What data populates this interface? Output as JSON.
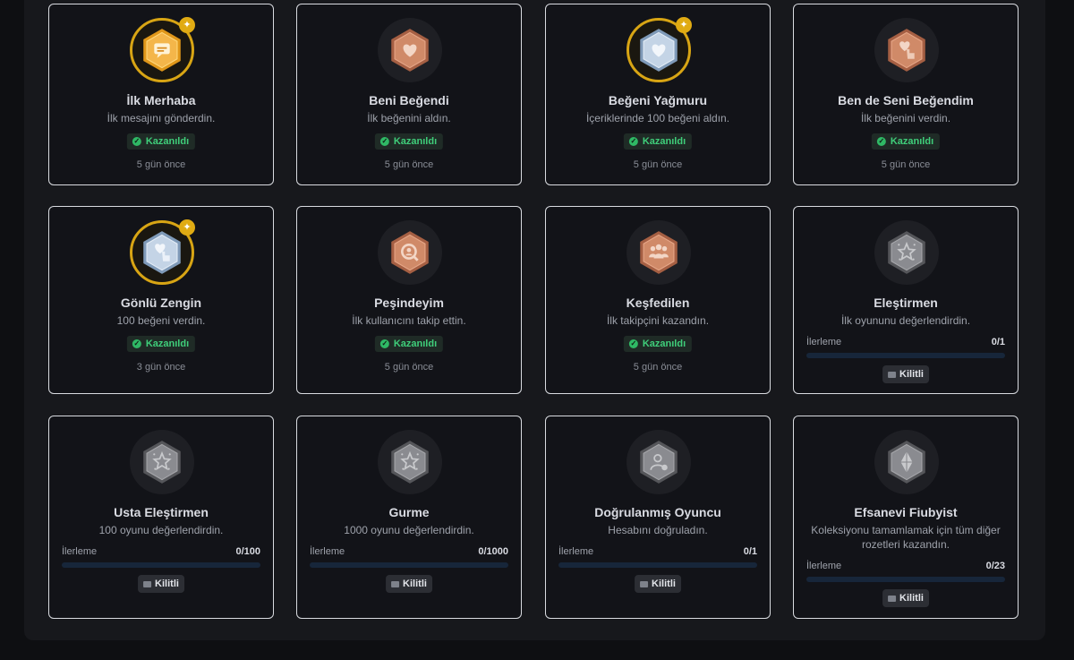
{
  "cards": [
    {
      "title": "İlk Merhaba",
      "desc": "İlk mesajını gönderdin.",
      "status": "Kazanıldı",
      "time": "5 gün önce",
      "tier": "gold",
      "icon": "chat-bubble-icon",
      "pinned": true
    },
    {
      "title": "Beni Beğendi",
      "desc": "İlk beğenini aldın.",
      "status": "Kazanıldı",
      "time": "5 gün önce",
      "tier": "bronze",
      "icon": "heart-icon",
      "pinned": false
    },
    {
      "title": "Beğeni Yağmuru",
      "desc": "İçeriklerinde 100 beğeni aldın.",
      "status": "Kazanıldı",
      "time": "5 gün önce",
      "tier": "silver",
      "icon": "hearts-icon",
      "pinned": true
    },
    {
      "title": "Ben de Seni Beğendim",
      "desc": "İlk beğenini verdin.",
      "status": "Kazanıldı",
      "time": "5 gün önce",
      "tier": "bronze",
      "icon": "heart-hand-icon",
      "pinned": false
    },
    {
      "title": "Gönlü Zengin",
      "desc": "100 beğeni verdin.",
      "status": "Kazanıldı",
      "time": "3 gün önce",
      "tier": "silver",
      "icon": "heart-hand-icon",
      "pinned": true
    },
    {
      "title": "Peşindeyim",
      "desc": "İlk kullanıcını takip ettin.",
      "status": "Kazanıldı",
      "time": "5 gün önce",
      "tier": "bronze",
      "icon": "magnifier-user-icon",
      "pinned": false
    },
    {
      "title": "Keşfedilen",
      "desc": "İlk takipçini kazandın.",
      "status": "Kazanıldı",
      "time": "5 gün önce",
      "tier": "bronze",
      "icon": "group-icon",
      "pinned": false
    },
    {
      "title": "Eleştirmen",
      "desc": "İlk oyununu değerlendirdin.",
      "tier": "locked",
      "icon": "star-icon",
      "progress_label": "İlerleme",
      "progress_text": "0/1",
      "progress": 0,
      "lock_label": "Kilitli"
    },
    {
      "title": "Usta Eleştirmen",
      "desc": "100 oyunu değerlendirdin.",
      "tier": "locked",
      "icon": "star-icon",
      "progress_label": "İlerleme",
      "progress_text": "0/100",
      "progress": 0,
      "lock_label": "Kilitli"
    },
    {
      "title": "Gurme",
      "desc": "1000 oyunu değerlendirdin.",
      "tier": "locked",
      "icon": "star-icon",
      "progress_label": "İlerleme",
      "progress_text": "0/1000",
      "progress": 0,
      "lock_label": "Kilitli"
    },
    {
      "title": "Doğrulanmış Oyuncu",
      "desc": "Hesabını doğruladın.",
      "tier": "locked",
      "icon": "verified-user-icon",
      "progress_label": "İlerleme",
      "progress_text": "0/1",
      "progress": 0,
      "lock_label": "Kilitli"
    },
    {
      "title": "Efsanevi Fiubyist",
      "desc": "Koleksiyonu tamamlamak için tüm diğer rozetleri kazandın.",
      "tier": "locked",
      "icon": "diamond-icon",
      "progress_label": "İlerleme",
      "progress_text": "0/23",
      "progress": 0,
      "lock_label": "Kilitli"
    }
  ],
  "colors": {
    "gold": "#f0a52a",
    "bronze": "#c27a5a",
    "silver": "#b8c9dc",
    "locked": "#7a7b80",
    "accent": "#d8a514",
    "success": "#3fce7a"
  },
  "pin_icon": "pin-icon",
  "lock_icon": "lock-icon",
  "check_icon": "check-icon"
}
